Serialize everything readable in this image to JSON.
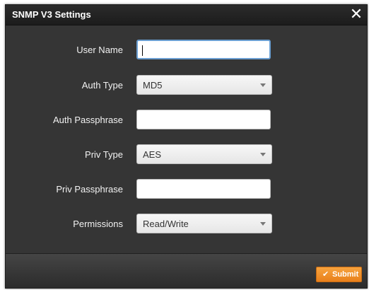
{
  "dialog": {
    "title": "SNMP V3 Settings",
    "close_icon": "close-icon"
  },
  "fields": {
    "user_name": {
      "label": "User Name",
      "value": ""
    },
    "auth_type": {
      "label": "Auth Type",
      "value": "MD5"
    },
    "auth_passphrase": {
      "label": "Auth Passphrase",
      "value": ""
    },
    "priv_type": {
      "label": "Priv Type",
      "value": "AES"
    },
    "priv_passphrase": {
      "label": "Priv Passphrase",
      "value": ""
    },
    "permissions": {
      "label": "Permissions",
      "value": "Read/Write"
    }
  },
  "footer": {
    "submit_label": "Submit",
    "submit_icon": "check-icon"
  },
  "colors": {
    "accent": "#f39a35",
    "dialog_bg": "#353535",
    "header_bg": "#1c1c1c"
  }
}
